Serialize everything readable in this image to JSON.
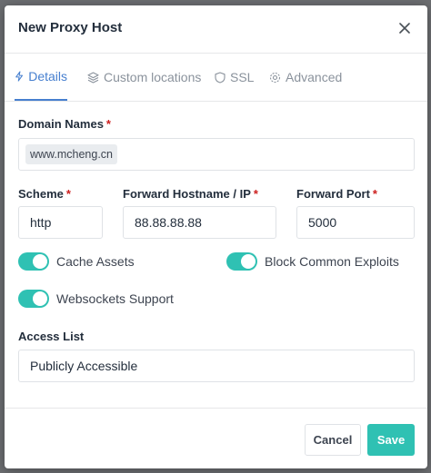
{
  "modal": {
    "title": "New Proxy Host"
  },
  "tabs": [
    {
      "label": "Details",
      "icon": "bolt-icon",
      "active": true
    },
    {
      "label": "Custom locations",
      "icon": "layers-icon",
      "active": false
    },
    {
      "label": "SSL",
      "icon": "shield-icon",
      "active": false
    },
    {
      "label": "Advanced",
      "icon": "gear-icon",
      "active": false
    }
  ],
  "form": {
    "domain_names": {
      "label": "Domain Names",
      "required_mark": "*",
      "tags": [
        "www.mcheng.cn"
      ]
    },
    "scheme": {
      "label": "Scheme",
      "required_mark": "*",
      "value": "http"
    },
    "forward_hostname": {
      "label": "Forward Hostname / IP",
      "required_mark": "*",
      "value": "88.88.88.88"
    },
    "forward_port": {
      "label": "Forward Port",
      "required_mark": "*",
      "value": "5000"
    },
    "toggles": [
      {
        "label": "Cache Assets",
        "on": true
      },
      {
        "label": "Block Common Exploits",
        "on": true
      },
      {
        "label": "Websockets Support",
        "on": true
      }
    ],
    "access_list": {
      "label": "Access List",
      "value": "Publicly Accessible"
    }
  },
  "footer": {
    "cancel_label": "Cancel",
    "save_label": "Save"
  },
  "colors": {
    "accent": "#467fcf",
    "toggle_on": "#2fc1b3",
    "save_button": "#2fc1b3",
    "required": "#cd201f"
  }
}
